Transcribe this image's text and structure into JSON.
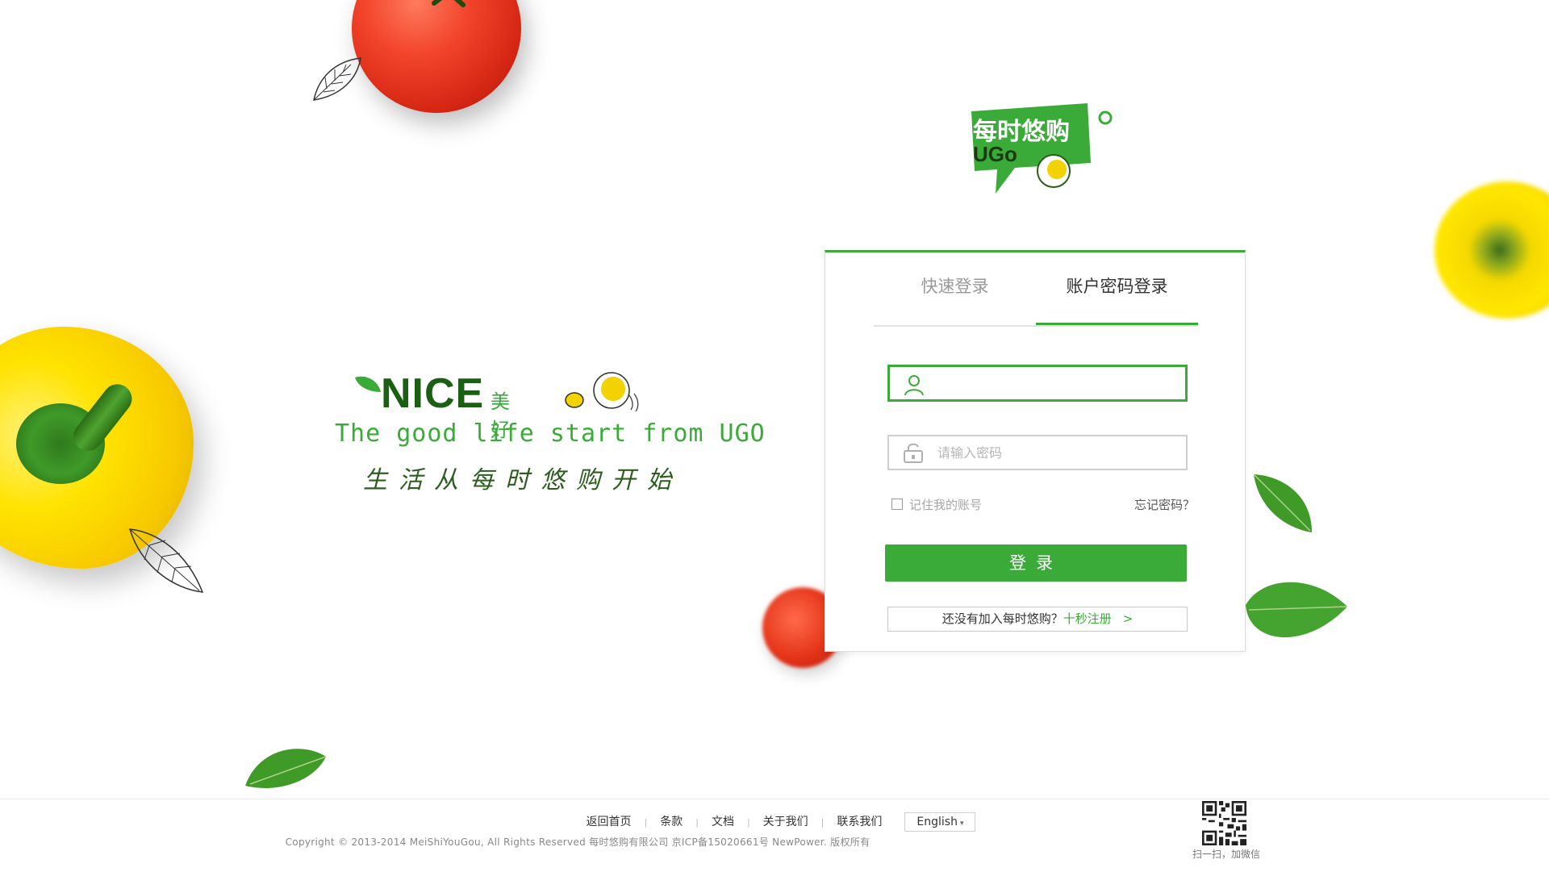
{
  "brand": {
    "logo_cn": "每时悠购",
    "logo_en": "UGo",
    "nice": "NICE",
    "nice_cn": "美好",
    "slogan_en": "The good life start from UGO",
    "slogan_cn": "生活从每时悠购开始"
  },
  "login": {
    "tabs": [
      {
        "label": "快速登录",
        "active": false
      },
      {
        "label": "账户密码登录",
        "active": true
      }
    ],
    "username": {
      "value": "",
      "placeholder": "",
      "icon": "user-icon"
    },
    "password": {
      "value": "",
      "placeholder": "请输入密码",
      "icon": "lock-icon"
    },
    "remember_label": "记住我的账号",
    "remember_checked": false,
    "forgot_label": "忘记密码？",
    "submit_label": "登录",
    "register_prefix": "还没有加入每时悠购？",
    "register_link": "十秒注册",
    "register_arrow": ">"
  },
  "footer": {
    "links": [
      "返回首页",
      "条款",
      "文档",
      "关于我们",
      "联系我们"
    ],
    "language": "English",
    "copyright": "Copyright © 2013-2014 MeiShiYouGou, All Rights Reserved 每时悠购有限公司 京ICP备15020661号 NewPower. 版权所有",
    "qr_caption": "扫一扫，加微信"
  },
  "colors": {
    "accent": "#3aaa38",
    "dark_green": "#1b5e14",
    "border": "#dcdcdc"
  }
}
